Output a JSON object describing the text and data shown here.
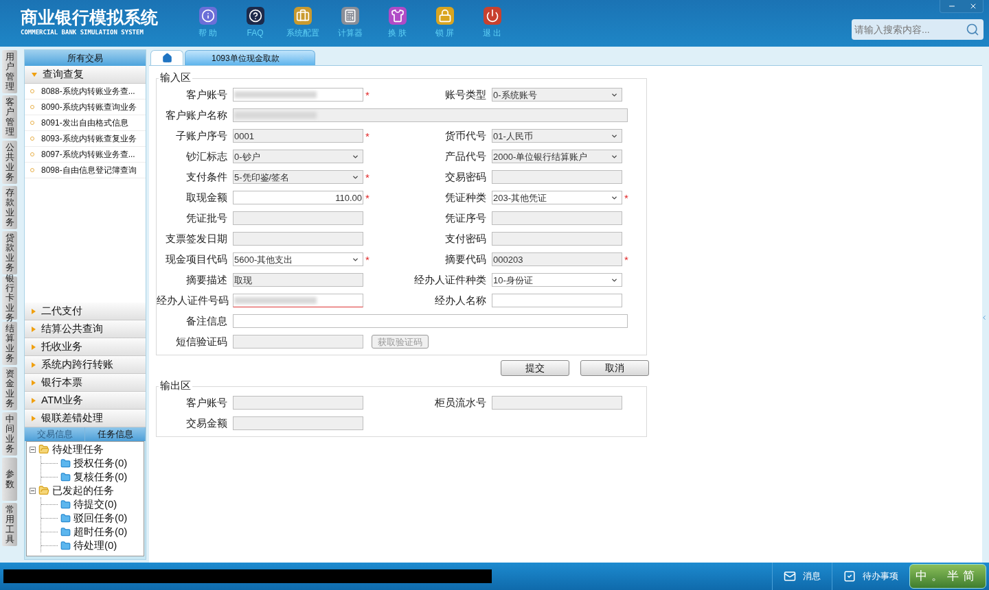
{
  "header": {
    "title": "商业银行模拟系统",
    "subtitle": "COMMERCIAL BANK SIMULATION SYSTEM",
    "toolbar": [
      {
        "kind": "info",
        "label": "帮 助"
      },
      {
        "kind": "help",
        "label": "FAQ"
      },
      {
        "kind": "config",
        "label": "系统配置"
      },
      {
        "kind": "calculator",
        "label": "计算器"
      },
      {
        "kind": "skin",
        "label": "换 肤"
      },
      {
        "kind": "lock",
        "label": "锁 屏"
      },
      {
        "kind": "exit",
        "label": "退 出"
      }
    ],
    "search": {
      "placeholder": "请输入搜索内容..."
    }
  },
  "side_tabs": [
    "用户管理",
    "客户管理",
    "公共业务",
    "存款业务",
    "贷款业务",
    "银行卡业务",
    "结算业务",
    "资金业务",
    "中间业务",
    "参数",
    "常用工具"
  ],
  "sidebar": {
    "title": "所有交易",
    "groups": [
      {
        "label": "查询查复",
        "expanded": true,
        "items": [
          "8088-系统内转账业务查...",
          "8090-系统内转账查询业务",
          "8091-发出自由格式信息",
          "8093-系统内转账查复业务",
          "8097-系统内转账业务查...",
          "8098-自由信息登记簿查询"
        ]
      },
      {
        "label": "二代支付",
        "expanded": false
      },
      {
        "label": "结算公共查询",
        "expanded": false
      },
      {
        "label": "托收业务",
        "expanded": false
      },
      {
        "label": "系统内跨行转账",
        "expanded": false
      },
      {
        "label": "银行本票",
        "expanded": false
      },
      {
        "label": "ATM业务",
        "expanded": false
      },
      {
        "label": "银联差错处理",
        "expanded": false
      }
    ],
    "info_tabs": [
      {
        "label": "交易信息",
        "selected": false
      },
      {
        "label": "任务信息",
        "selected": true
      }
    ],
    "tree": [
      {
        "label": "待处理任务",
        "expanded": true,
        "children": [
          {
            "label": "授权任务(0)"
          },
          {
            "label": "复核任务(0)"
          }
        ]
      },
      {
        "label": "已发起的任务",
        "expanded": true,
        "children": [
          {
            "label": "待提交(0)"
          },
          {
            "label": "驳回任务(0)"
          },
          {
            "label": "超时任务(0)"
          },
          {
            "label": "待处理(0)"
          }
        ]
      }
    ]
  },
  "tabs": [
    {
      "kind": "home",
      "selected": false
    },
    {
      "kind": "page",
      "label": "1093单位现金取款",
      "selected": true
    }
  ],
  "required_mark": "*",
  "input_area": {
    "title": "输入区",
    "rows": [
      [
        {
          "label": "客户账号",
          "kind": "text",
          "blurred": true,
          "editable": true,
          "required": true
        },
        {
          "label": "账号类型",
          "kind": "select",
          "value": "0-系统账号",
          "editable": false,
          "required": false
        }
      ],
      [
        {
          "label": "客户账户名称",
          "kind": "text",
          "wide": true,
          "blurred": true,
          "editable": false,
          "required": false
        }
      ],
      [
        {
          "label": "子账户序号",
          "kind": "text",
          "value": "0001",
          "editable": false,
          "required": true
        },
        {
          "label": "货币代号",
          "kind": "select",
          "value": "01-人民币",
          "editable": false,
          "required": false
        }
      ],
      [
        {
          "label": "钞汇标志",
          "kind": "select",
          "value": "0-钞户",
          "editable": false,
          "required": false
        },
        {
          "label": "产品代号",
          "kind": "select",
          "value": "2000-单位银行结算账户",
          "editable": false,
          "required": false
        }
      ],
      [
        {
          "label": "支付条件",
          "kind": "select",
          "value": "5-凭印鉴/签名",
          "editable": false,
          "required": true
        },
        {
          "label": "交易密码",
          "kind": "text",
          "editable": false,
          "required": false
        }
      ],
      [
        {
          "label": "取现金额",
          "kind": "number",
          "value": "110.00",
          "editable": true,
          "required": true
        },
        {
          "label": "凭证种类",
          "kind": "select",
          "value": "203-其他凭证",
          "editable": true,
          "required": true
        }
      ],
      [
        {
          "label": "凭证批号",
          "kind": "text",
          "editable": false,
          "required": false
        },
        {
          "label": "凭证序号",
          "kind": "text",
          "editable": false,
          "required": false
        }
      ],
      [
        {
          "label": "支票签发日期",
          "kind": "text",
          "editable": false,
          "required": false
        },
        {
          "label": "支付密码",
          "kind": "text",
          "editable": false,
          "required": false
        }
      ],
      [
        {
          "label": "现金项目代码",
          "kind": "select",
          "value": "5600-其他支出",
          "editable": true,
          "required": true
        },
        {
          "label": "摘要代码",
          "kind": "text",
          "value": "000203",
          "editable": false,
          "required": true
        }
      ],
      [
        {
          "label": "摘要描述",
          "kind": "text",
          "value": "取现",
          "editable": false,
          "required": false
        },
        {
          "label": "经办人证件种类",
          "kind": "select",
          "value": "10-身份证",
          "editable": true,
          "required": false
        }
      ],
      [
        {
          "label": "经办人证件号码",
          "kind": "text",
          "blurred": true,
          "invalid": true,
          "editable": true,
          "required": false
        },
        {
          "label": "经办人名称",
          "kind": "text",
          "editable": true,
          "required": false
        }
      ],
      [
        {
          "label": "备注信息",
          "kind": "text",
          "wide": true,
          "editable": true,
          "required": false
        }
      ],
      [
        {
          "label": "短信验证码",
          "kind": "text",
          "editable": false,
          "required": false,
          "button": {
            "label": "获取验证码",
            "disabled": true
          }
        }
      ]
    ]
  },
  "actions": [
    "提交",
    "取消"
  ],
  "output_area": {
    "title": "输出区",
    "rows": [
      [
        {
          "label": "客户账号",
          "editable": false,
          "required": false
        },
        {
          "label": "柜员流水号",
          "editable": false,
          "required": false
        }
      ],
      [
        {
          "label": "交易金额",
          "editable": false,
          "required": false
        }
      ]
    ]
  },
  "status_bar": {
    "items": [
      {
        "kind": "message",
        "label": "消息"
      },
      {
        "kind": "todo",
        "label": "待办事项"
      }
    ],
    "ime": [
      "中",
      "。",
      "半",
      "简"
    ]
  }
}
